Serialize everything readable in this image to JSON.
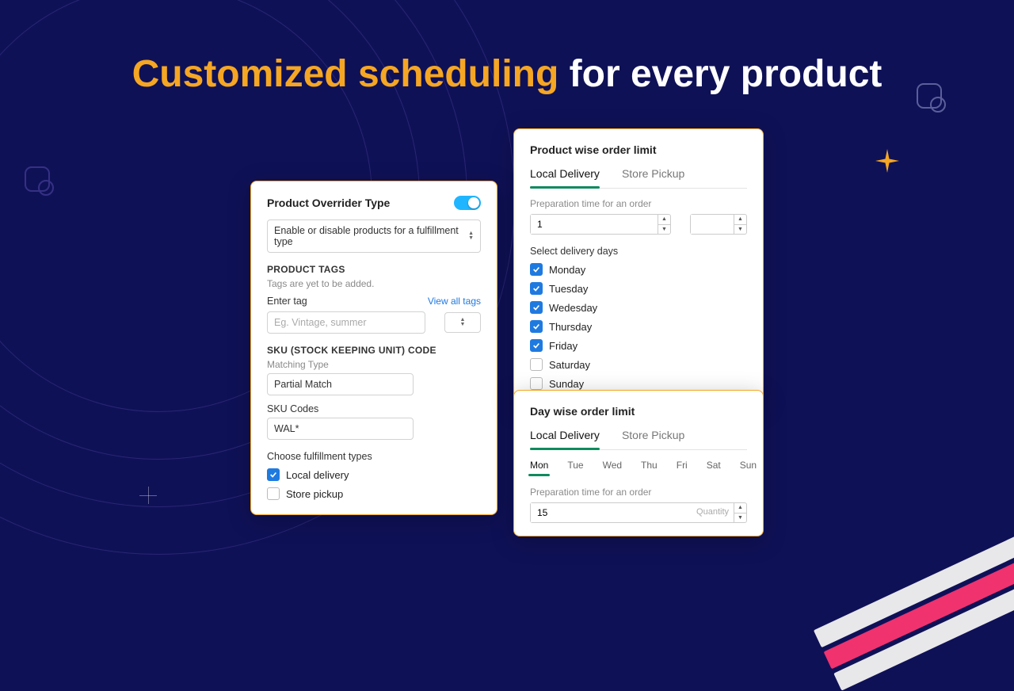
{
  "hero": {
    "accent": "Customized scheduling",
    "rest": " for every product"
  },
  "left": {
    "title": "Product Overrider Type",
    "select_value": "Enable or disable products for a fulfillment type",
    "tags_heading": "PRODUCT TAGS",
    "tags_note": "Tags are yet to be added.",
    "enter_tag_label": "Enter tag",
    "view_all": "View all tags",
    "tag_placeholder": "Eg. Vintage, summer",
    "sku_heading": "SKU (STOCK KEEPING UNIT) CODE",
    "matching_type_label": "Matching Type",
    "matching_type_value": "Partial Match",
    "sku_codes_label": "SKU Codes",
    "sku_codes_value": "WAL*",
    "fulfillment_label": "Choose fulfillment types",
    "opt_local": "Local delivery",
    "opt_store": "Store pickup"
  },
  "tr": {
    "title": "Product wise order limit",
    "tab_local": "Local Delivery",
    "tab_store": "Store Pickup",
    "prep_label": "Preparation time for an order",
    "prep_value": "1",
    "select_days_label": "Select delivery days",
    "days": [
      {
        "label": "Monday",
        "checked": true
      },
      {
        "label": "Tuesday",
        "checked": true
      },
      {
        "label": "Wedesday",
        "checked": true
      },
      {
        "label": "Thursday",
        "checked": true
      },
      {
        "label": "Friday",
        "checked": true
      },
      {
        "label": "Saturday",
        "checked": false
      },
      {
        "label": "Sunday",
        "checked": false
      }
    ]
  },
  "br": {
    "title": "Day wise order limit",
    "tab_local": "Local Delivery",
    "tab_store": "Store Pickup",
    "daytabs": [
      "Mon",
      "Tue",
      "Wed",
      "Thu",
      "Fri",
      "Sat",
      "Sun"
    ],
    "prep_label": "Preparation time for an order",
    "qty_value": "15",
    "qty_label": "Quantity"
  }
}
